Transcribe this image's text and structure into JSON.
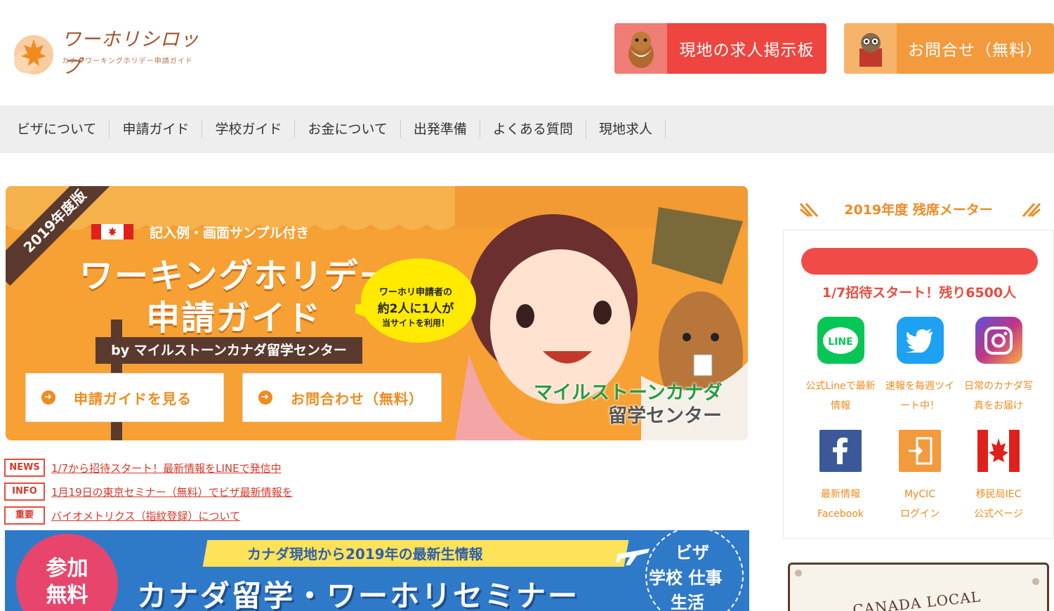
{
  "header": {
    "logo_title": "ワーホリシロップ",
    "logo_subtitle": "カナダワーキングホリデー申請ガイド",
    "jobs_button": "現地の求人掲示板",
    "contact_button": "お問合せ（無料）"
  },
  "nav": {
    "items": [
      "ビザについて",
      "申請ガイド",
      "学校ガイド",
      "お金について",
      "出発準備",
      "よくある質問",
      "現地求人"
    ]
  },
  "hero": {
    "badge": "2019年度版",
    "sample_text": "記入例・画面サンプル付き",
    "title_line1": "ワーキングホリデー",
    "title_line2": "申請ガイド",
    "byline": "by マイルストーンカナダ留学センター",
    "bubble_line1": "ワーホリ申請者の",
    "bubble_line2": "約2人に1人が",
    "bubble_line3": "当サイトを利用！",
    "button_guide": "申請ガイドを見る",
    "button_contact": "お問合わせ（無料）",
    "brand_line1": "マイルストーンカナダ",
    "brand_line2": "留学センター"
  },
  "news": [
    {
      "tag": "NEWS",
      "text": "1/7から招待スタート！最新情報をLINEで発信中"
    },
    {
      "tag": "INFO",
      "text": "1月19日の東京セミナー（無料）でビザ最新情報を"
    },
    {
      "tag": "重要",
      "text": "バイオメトリクス（指紋登録）について"
    }
  ],
  "seminar": {
    "free_line1": "参加",
    "free_line2": "無料",
    "ribbon": "カナダ現地から2019年の最新生情報",
    "title": "カナダ留学・ワーホリセミナー",
    "circle_line1": "ビザ",
    "circle_line2": "学校 仕事",
    "circle_line3": "生活"
  },
  "sidebar": {
    "meter_title": "2019年度 残席メーター",
    "meter_fill_fraction": 1.0,
    "meter_text": "1/7招待スタート！残り6500人",
    "sns": [
      {
        "icon": "line-icon",
        "caption1": "公式Lineで最新",
        "caption2": "情報",
        "color": "#06c755"
      },
      {
        "icon": "twitter-icon",
        "caption1": "速報を毎週ツイ",
        "caption2": "ート中！",
        "color": "#1da1f2"
      },
      {
        "icon": "instagram-icon",
        "caption1": "日常のカナダ写",
        "caption2": "真をお届け",
        "color": "#d6249f"
      },
      {
        "icon": "facebook-icon",
        "caption1": "最新情報",
        "caption2": "Facebook",
        "color": "#3b5998"
      },
      {
        "icon": "mycic-icon",
        "caption1": "MyCIC",
        "caption2": "ログイン",
        "color": "#f39a3c"
      },
      {
        "icon": "canada-flag-icon",
        "caption1": "移民局IEC",
        "caption2": "公式ページ",
        "color": "#e0211b"
      }
    ],
    "classified": "CANADA LOCAL CLASSIFIED"
  },
  "colors": {
    "accent_orange": "#f08b1e",
    "accent_red": "#ee4540",
    "nav_bg": "#eeeeee"
  }
}
